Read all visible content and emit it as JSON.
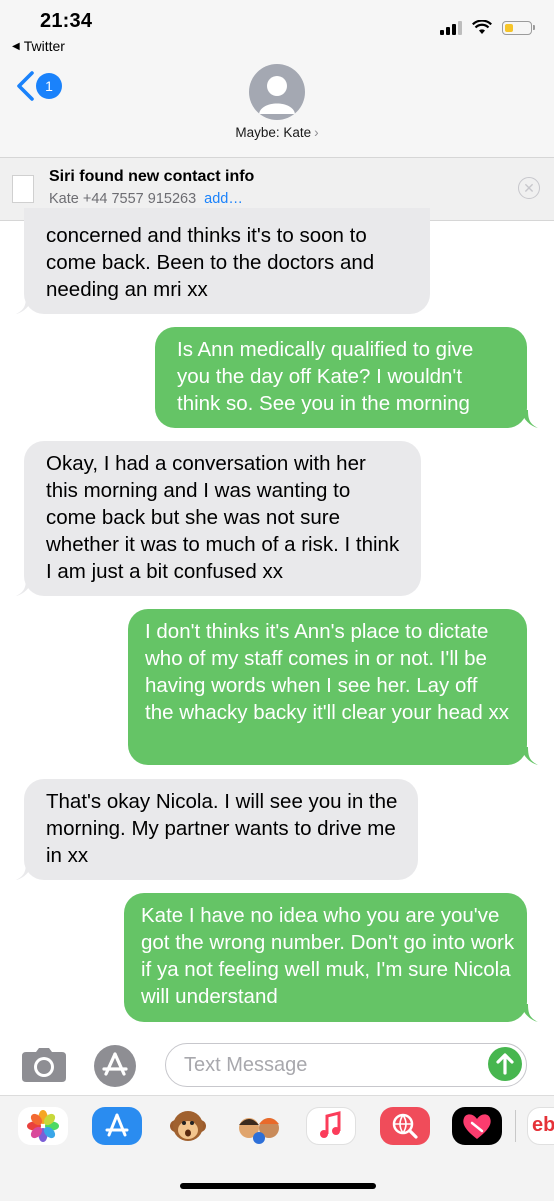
{
  "status": {
    "time": "21:34",
    "back_app": "Twitter",
    "battery_color": "#f6c52a"
  },
  "header": {
    "unread_count": "1",
    "contact_name": "Maybe: Kate",
    "chevron": "›"
  },
  "siri_banner": {
    "title": "Siri found new contact info",
    "contact": "Kate +44 7557 915263",
    "add_label": "add…",
    "close_icon": "close-circle-icon"
  },
  "messages": [
    {
      "direction": "incoming",
      "text": "concerned and thinks it's to soon to come back. Been to the doctors and needing an mri xx"
    },
    {
      "direction": "outgoing",
      "text": "Is Ann medically qualified to give you the day off Kate? I wouldn't think so. See you in the morning"
    },
    {
      "direction": "incoming",
      "text": "Okay, I had a conversation with her this morning and I was wanting to come back but she was not sure whether it was to much of a risk. I think I am just a bit confused xx"
    },
    {
      "direction": "outgoing",
      "text": "I don't thinks it's Ann's place to dictate who of my staff comes in or not. I'll be having words when I see her. Lay off the whacky backy it'll clear your head xx"
    },
    {
      "direction": "incoming",
      "text": "That's okay Nicola. I will see you in the morning. My partner wants to drive me in xx"
    },
    {
      "direction": "outgoing",
      "text": "Kate I have no idea who you are you've got the wrong number. Don't go into work if ya not feeling well muk, I'm sure Nicola will understand"
    }
  ],
  "input": {
    "placeholder": "Text Message",
    "send_icon": "arrow-up-icon",
    "camera_icon": "camera-icon",
    "apps_icon": "app-store-icon"
  },
  "app_strip": {
    "apps": [
      "photos-icon",
      "app-store-icon",
      "monkey-animoji-icon",
      "memoji-icon",
      "music-icon",
      "images-search-icon",
      "digital-touch-icon",
      "ebay-icon"
    ],
    "ebay_label": "eb"
  },
  "colors": {
    "incoming_bubble": "#e9e9eb",
    "outgoing_bubble": "#65c466",
    "accent_blue": "#1a82fb",
    "send_green": "#47b64f"
  }
}
